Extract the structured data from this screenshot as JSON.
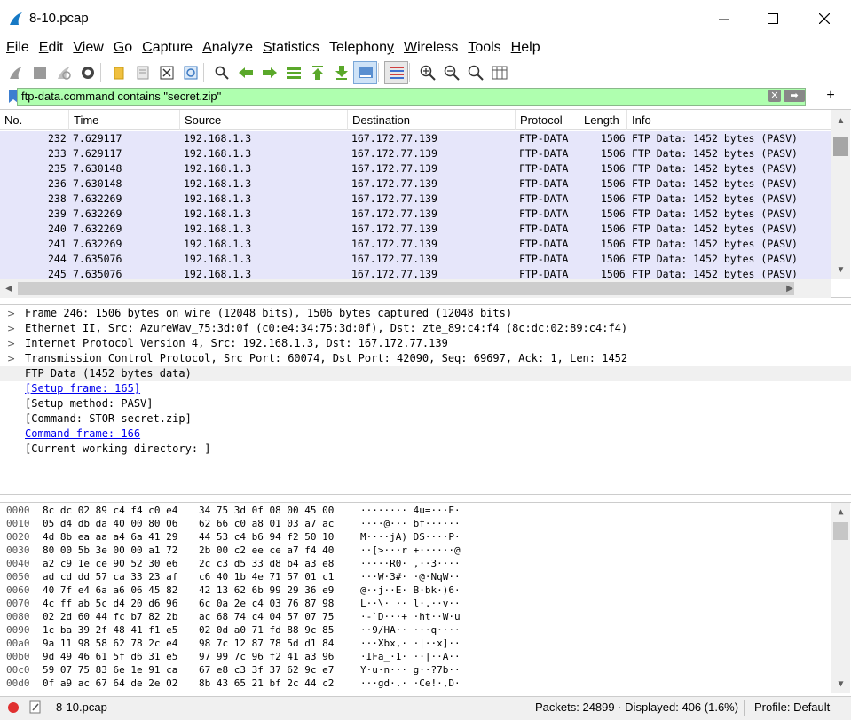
{
  "window": {
    "title": "8-10.pcap",
    "minimize": "—",
    "maximize": "☐",
    "close": "✕"
  },
  "menu": [
    {
      "accel": "F",
      "rest": "ile"
    },
    {
      "accel": "E",
      "rest": "dit"
    },
    {
      "accel": "V",
      "rest": "iew"
    },
    {
      "accel": "G",
      "rest": "o"
    },
    {
      "accel": "C",
      "rest": "apture"
    },
    {
      "accel": "A",
      "rest": "nalyze"
    },
    {
      "accel": "S",
      "rest": "tatistics"
    },
    {
      "accel": "",
      "rest": "Telephon",
      "tail_accel": "y"
    },
    {
      "accel": "W",
      "rest": "ireless"
    },
    {
      "accel": "T",
      "rest": "ools"
    },
    {
      "accel": "H",
      "rest": "elp"
    }
  ],
  "filter": {
    "value": "ftp-data.command contains \"secret.zip\"",
    "clear": "✕",
    "apply": "➡",
    "add": "+"
  },
  "columns": [
    "No.",
    "Time",
    "Source",
    "Destination",
    "Protocol",
    "Length",
    "Info"
  ],
  "packets": [
    {
      "no": "232",
      "time": "7.629117",
      "src": "192.168.1.3",
      "dst": "167.172.77.139",
      "proto": "FTP-DATA",
      "len": "1506",
      "info": "FTP Data: 1452 bytes (PASV)"
    },
    {
      "no": "233",
      "time": "7.629117",
      "src": "192.168.1.3",
      "dst": "167.172.77.139",
      "proto": "FTP-DATA",
      "len": "1506",
      "info": "FTP Data: 1452 bytes (PASV)"
    },
    {
      "no": "235",
      "time": "7.630148",
      "src": "192.168.1.3",
      "dst": "167.172.77.139",
      "proto": "FTP-DATA",
      "len": "1506",
      "info": "FTP Data: 1452 bytes (PASV)"
    },
    {
      "no": "236",
      "time": "7.630148",
      "src": "192.168.1.3",
      "dst": "167.172.77.139",
      "proto": "FTP-DATA",
      "len": "1506",
      "info": "FTP Data: 1452 bytes (PASV)"
    },
    {
      "no": "238",
      "time": "7.632269",
      "src": "192.168.1.3",
      "dst": "167.172.77.139",
      "proto": "FTP-DATA",
      "len": "1506",
      "info": "FTP Data: 1452 bytes (PASV)"
    },
    {
      "no": "239",
      "time": "7.632269",
      "src": "192.168.1.3",
      "dst": "167.172.77.139",
      "proto": "FTP-DATA",
      "len": "1506",
      "info": "FTP Data: 1452 bytes (PASV)"
    },
    {
      "no": "240",
      "time": "7.632269",
      "src": "192.168.1.3",
      "dst": "167.172.77.139",
      "proto": "FTP-DATA",
      "len": "1506",
      "info": "FTP Data: 1452 bytes (PASV)"
    },
    {
      "no": "241",
      "time": "7.632269",
      "src": "192.168.1.3",
      "dst": "167.172.77.139",
      "proto": "FTP-DATA",
      "len": "1506",
      "info": "FTP Data: 1452 bytes (PASV)"
    },
    {
      "no": "244",
      "time": "7.635076",
      "src": "192.168.1.3",
      "dst": "167.172.77.139",
      "proto": "FTP-DATA",
      "len": "1506",
      "info": "FTP Data: 1452 bytes (PASV)"
    },
    {
      "no": "245",
      "time": "7.635076",
      "src": "192.168.1.3",
      "dst": "167.172.77.139",
      "proto": "FTP-DATA",
      "len": "1506",
      "info": "FTP Data: 1452 bytes (PASV)"
    }
  ],
  "details": [
    {
      "expander": ">",
      "text": "Frame 246: 1506 bytes on wire (12048 bits), 1506 bytes captured (12048 bits)",
      "link": false
    },
    {
      "expander": ">",
      "text": "Ethernet II, Src: AzureWav_75:3d:0f (c0:e4:34:75:3d:0f), Dst: zte_89:c4:f4 (8c:dc:02:89:c4:f4)",
      "link": false
    },
    {
      "expander": ">",
      "text": "Internet Protocol Version 4, Src: 192.168.1.3, Dst: 167.172.77.139",
      "link": false
    },
    {
      "expander": ">",
      "text": "Transmission Control Protocol, Src Port: 60074, Dst Port: 42090, Seq: 69697, Ack: 1, Len: 1452",
      "link": false
    },
    {
      "expander": "",
      "text": "FTP Data (1452 bytes data)",
      "link": false,
      "selected": true
    },
    {
      "expander": "",
      "text": "[Setup frame: 165]",
      "link": true
    },
    {
      "expander": "",
      "text": "[Setup method: PASV]",
      "link": false
    },
    {
      "expander": "",
      "text": "[Command: STOR secret.zip]",
      "link": false
    },
    {
      "expander": "",
      "text": "Command frame: 166",
      "link": true
    },
    {
      "expander": "",
      "text": "[Current working directory: ]",
      "link": false
    }
  ],
  "bytes": [
    {
      "off": "0000",
      "hex1": "8c dc 02 89 c4 f4 c0 e4",
      "hex2": "34 75 3d 0f 08 00 45 00",
      "ascii": "········ 4u=···E·"
    },
    {
      "off": "0010",
      "hex1": "05 d4 db da 40 00 80 06",
      "hex2": "62 66 c0 a8 01 03 a7 ac",
      "ascii": "····@··· bf······"
    },
    {
      "off": "0020",
      "hex1": "4d 8b ea aa a4 6a 41 29",
      "hex2": "44 53 c4 b6 94 f2 50 10",
      "ascii": "M····jA) DS····P·"
    },
    {
      "off": "0030",
      "hex1": "80 00 5b 3e 00 00 a1 72",
      "hex2": "2b 00 c2 ee ce a7 f4 40",
      "ascii": "··[>···r +······@"
    },
    {
      "off": "0040",
      "hex1": "a2 c9 1e ce 90 52 30 e6",
      "hex2": "2c c3 d5 33 d8 b4 a3 e8",
      "ascii": "·····R0· ,··3····"
    },
    {
      "off": "0050",
      "hex1": "ad cd dd 57 ca 33 23 af",
      "hex2": "c6 40 1b 4e 71 57 01 c1",
      "ascii": "···W·3#· ·@·NqW··"
    },
    {
      "off": "0060",
      "hex1": "40 7f e4 6a a6 06 45 82",
      "hex2": "42 13 62 6b 99 29 36 e9",
      "ascii": "@··j··E· B·bk·)6·"
    },
    {
      "off": "0070",
      "hex1": "4c ff ab 5c d4 20 d6 96",
      "hex2": "6c 0a 2e c4 03 76 87 98",
      "ascii": "L··\\· ·· l·.··v··"
    },
    {
      "off": "0080",
      "hex1": "02 2d 60 44 fc b7 82 2b",
      "hex2": "ac 68 74 c4 04 57 07 75",
      "ascii": "·-`D···+ ·ht··W·u"
    },
    {
      "off": "0090",
      "hex1": "1c ba 39 2f 48 41 f1 e5",
      "hex2": "02 0d a0 71 fd 88 9c 85",
      "ascii": "··9/HA·· ···q····"
    },
    {
      "off": "00a0",
      "hex1": "9a 11 98 58 62 78 2c e4",
      "hex2": "98 7c 12 87 78 5d d1 84",
      "ascii": "···Xbx,· ·|··x]··"
    },
    {
      "off": "00b0",
      "hex1": "9d 49 46 61 5f d6 31 e5",
      "hex2": "97 99 7c 96 f2 41 a3 96",
      "ascii": "·IFa_·1· ··|··A··"
    },
    {
      "off": "00c0",
      "hex1": "59 07 75 83 6e 1e 91 ca",
      "hex2": "67 e8 c3 3f 37 62 9c e7",
      "ascii": "Y·u·n··· g··?7b··"
    },
    {
      "off": "00d0",
      "hex1": "0f a9 ac 67 64 de 2e 02",
      "hex2": "8b 43 65 21 bf 2c 44 c2",
      "ascii": "···gd·.· ·Ce!·,D·"
    }
  ],
  "status": {
    "file": "8-10.pcap",
    "packets": "Packets: 24899 · Displayed: 406 (1.6%)",
    "profile": "Profile: Default"
  },
  "colors": {
    "row_bg": "#e6e6fa",
    "filter_ok": "#afffaf",
    "link": "#0000ee"
  }
}
